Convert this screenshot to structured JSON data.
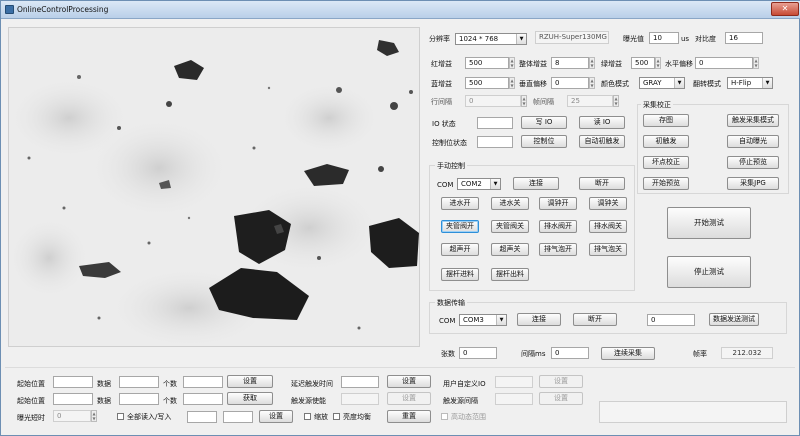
{
  "window": {
    "title": "OnlineControlProcessing"
  },
  "camera": {
    "resolution_label": "分辨率",
    "resolution_value": "1024 * 768",
    "device_name": "RZUH-Super130MG",
    "exposure_label": "曝光值",
    "exposure_value": "10",
    "exposure_unit": "us",
    "contrast_label": "对比度",
    "contrast_value": "16",
    "red_gain_label": "红增益",
    "red_gain_value": "500",
    "overall_gain_label": "整体增益",
    "overall_gain_value": "8",
    "green_gain_label": "绿增益",
    "green_gain_value": "500",
    "h_offset_label": "水平偏移",
    "h_offset_value": "0",
    "blue_gain_label": "蓝增益",
    "blue_gain_value": "500",
    "v_offset_label": "垂直偏移",
    "v_offset_value": "0",
    "color_mode_label": "颜色模式",
    "color_mode_value": "GRAY",
    "flip_mode_label": "翻转模式",
    "flip_mode_value": "H-Flip",
    "row_interval_label": "行间隔",
    "row_interval_value": "0",
    "frame_interval_label": "帧间隔",
    "frame_interval_value": "25"
  },
  "io": {
    "status_label": "IO 状态",
    "write_button": "写 IO",
    "read_button": "读 IO",
    "control_status_label": "控制位状态",
    "control_button": "控制位",
    "auto_trigger_button": "自动初触发"
  },
  "capture": {
    "group_label": "采集校正",
    "buttons": [
      "存图",
      "触发采集模式",
      "初触发",
      "自动曝光",
      "坏点校正",
      "停止预览",
      "开始预览",
      "采集JPG"
    ]
  },
  "manual": {
    "group_label": "手动控制",
    "com_label": "COM",
    "com_value": "COM2",
    "connect_button": "连接",
    "disconnect_button": "断开",
    "buttons": [
      [
        "进水开",
        "进水关",
        "调钟开",
        "调钟关"
      ],
      [
        "夹管阀开",
        "夹管阀关",
        "排水阀开",
        "排水阀关"
      ],
      [
        "超声开",
        "超声关",
        "排气泡开",
        "排气泡关"
      ],
      [
        "摆杆进料",
        "摆杆出料"
      ]
    ]
  },
  "test": {
    "start_button": "开始测试",
    "stop_button": "停止测试"
  },
  "transfer": {
    "group_label": "数据传输",
    "com_label": "COM",
    "com_value": "COM3",
    "connect_button": "连接",
    "disconnect_button": "断开",
    "count_value": "0",
    "send_test_button": "数据发送测试"
  },
  "acquisition": {
    "sheets_label": "张数",
    "sheets_value": "0",
    "interval_label": "间隔ms",
    "interval_value": "0",
    "continuous_button": "连续采集",
    "fps_label": "帧率",
    "fps_value": "212.032"
  },
  "bottom": {
    "start_pos_label": "起始位置",
    "data_label": "数据",
    "count_label": "个数",
    "set_button": "设置",
    "get_button": "获取",
    "exposure_short_label": "曝光短时",
    "exposure_short_value": "0",
    "read_all_label": "全部读入/写入",
    "set_button2": "设置",
    "delay_label": "延迟触发时间",
    "delay_set": "设置",
    "trigger_enable_label": "触发源使能",
    "trigger_enable_set": "设置",
    "zoom_label": "缩放",
    "brightness_label": "亮度均衡",
    "reset_button": "重置",
    "user_io_label": "用户自定义IO",
    "user_io_set": "设置",
    "trigger_interval_label": "触发源间隔",
    "trigger_interval_set": "设置",
    "hdr_label": "高动态范围"
  }
}
